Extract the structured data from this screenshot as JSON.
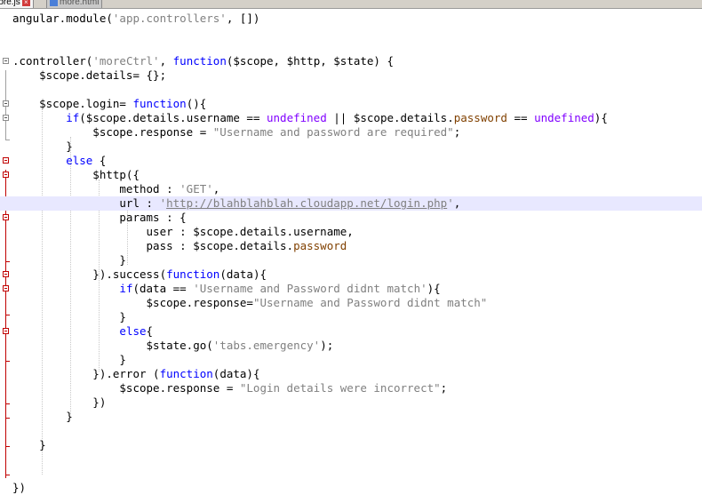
{
  "tabs": [
    {
      "label": "more.js",
      "active": true
    },
    {
      "label": "more.html",
      "active": false
    }
  ],
  "editor": {
    "lines": [
      [
        {
          "t": "angular.module("
        },
        {
          "t": "'app.controllers'",
          "c": "str"
        },
        {
          "t": ", [])"
        }
      ],
      [],
      [],
      [
        {
          "t": ".controller("
        },
        {
          "t": "'moreCtrl'",
          "c": "str"
        },
        {
          "t": ", "
        },
        {
          "t": "function",
          "c": "kw"
        },
        {
          "t": "($scope, $http, $state) {"
        }
      ],
      [
        {
          "t": "    $scope.details= {};"
        }
      ],
      [],
      [
        {
          "t": "    $scope.login= "
        },
        {
          "t": "function",
          "c": "kw"
        },
        {
          "t": "(){"
        }
      ],
      [
        {
          "t": "        "
        },
        {
          "t": "if",
          "c": "kw"
        },
        {
          "t": "($scope.details.username == "
        },
        {
          "t": "undefined",
          "c": "und"
        },
        {
          "t": " || $scope.details."
        },
        {
          "t": "password",
          "c": "pwd"
        },
        {
          "t": " == "
        },
        {
          "t": "undefined",
          "c": "und"
        },
        {
          "t": "){"
        }
      ],
      [
        {
          "t": "            $scope.response = "
        },
        {
          "t": "\"Username and password are required\"",
          "c": "str"
        },
        {
          "t": ";"
        }
      ],
      [
        {
          "t": "        }"
        }
      ],
      [
        {
          "t": "        "
        },
        {
          "t": "else",
          "c": "kw"
        },
        {
          "t": " {"
        }
      ],
      [
        {
          "t": "            $http({"
        }
      ],
      [
        {
          "t": "                method : "
        },
        {
          "t": "'GET'",
          "c": "str"
        },
        {
          "t": ","
        }
      ],
      [
        {
          "t": "                url : "
        },
        {
          "t": "'",
          "c": "str"
        },
        {
          "t": "http://blahblahblah.cloudapp.net/login.php",
          "c": "str url"
        },
        {
          "t": "'",
          "c": "str"
        },
        {
          "t": ","
        }
      ],
      [
        {
          "t": "                params : {"
        }
      ],
      [
        {
          "t": "                    user : $scope.details.username,"
        }
      ],
      [
        {
          "t": "                    pass : $scope.details."
        },
        {
          "t": "password",
          "c": "pwd"
        }
      ],
      [
        {
          "t": "                }"
        }
      ],
      [
        {
          "t": "            }).success("
        },
        {
          "t": "function",
          "c": "kw"
        },
        {
          "t": "(data){"
        }
      ],
      [
        {
          "t": "                "
        },
        {
          "t": "if",
          "c": "kw"
        },
        {
          "t": "(data == "
        },
        {
          "t": "'Username and Password didnt match'",
          "c": "str"
        },
        {
          "t": "){"
        }
      ],
      [
        {
          "t": "                    $scope.response="
        },
        {
          "t": "\"Username and Password didnt match\"",
          "c": "str"
        }
      ],
      [
        {
          "t": "                }"
        }
      ],
      [
        {
          "t": "                "
        },
        {
          "t": "else",
          "c": "kw"
        },
        {
          "t": "{"
        }
      ],
      [
        {
          "t": "                    $state.go("
        },
        {
          "t": "'tabs.emergency'",
          "c": "str"
        },
        {
          "t": ");"
        }
      ],
      [
        {
          "t": "                }"
        }
      ],
      [
        {
          "t": "            }).error ("
        },
        {
          "t": "function",
          "c": "kw"
        },
        {
          "t": "(data){"
        }
      ],
      [
        {
          "t": "                $scope.response = "
        },
        {
          "t": "\"Login details were incorrect\"",
          "c": "str"
        },
        {
          "t": ";"
        }
      ],
      [
        {
          "t": "            })"
        }
      ],
      [
        {
          "t": "        }"
        }
      ],
      [],
      [
        {
          "t": "    }"
        }
      ],
      [],
      [],
      [
        {
          "t": "})"
        }
      ]
    ],
    "highlighted_line": 14,
    "fold_markers": [
      {
        "line": 4,
        "red": false
      },
      {
        "line": 7,
        "red": false
      },
      {
        "line": 8,
        "red": false
      },
      {
        "line": 11,
        "red": true
      },
      {
        "line": 12,
        "red": true
      },
      {
        "line": 15,
        "red": true
      },
      {
        "line": 19,
        "red": true
      },
      {
        "line": 20,
        "red": true
      },
      {
        "line": 23,
        "red": true
      }
    ]
  },
  "colors": {
    "keyword": "#0000ff",
    "string": "#808080",
    "undefined": "#8000ff",
    "property": "#804000",
    "fold_active": "#c00000"
  }
}
